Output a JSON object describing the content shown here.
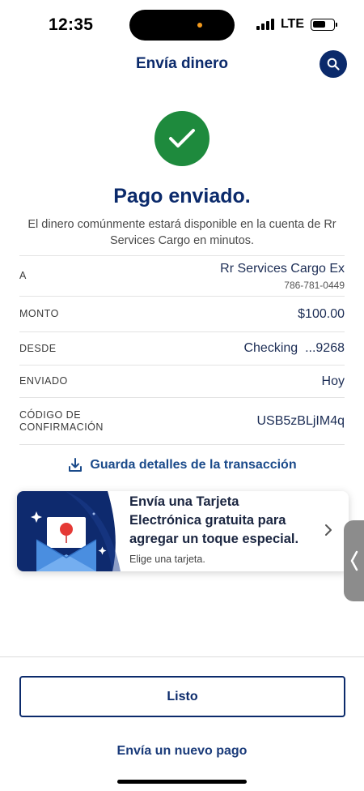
{
  "status_bar": {
    "time": "12:35",
    "network": "LTE",
    "camera_indicator_color": "#f39a1d"
  },
  "header": {
    "title": "Envía dinero",
    "search_icon": "search-icon"
  },
  "confirmation": {
    "icon": "checkmark-icon",
    "success_color": "#1e8a3d",
    "headline": "Pago enviado.",
    "message": "El dinero comúnmente estará disponible en la cuenta de Rr Services Cargo en minutos."
  },
  "details": {
    "recipient": {
      "label": "A",
      "value": "Rr Services Cargo Ex",
      "phone": "786-781-0449"
    },
    "amount": {
      "label": "MONTO",
      "value": "$100.00"
    },
    "from": {
      "label": "DESDE",
      "account": "Checking",
      "account_suffix": "...9268"
    },
    "sent": {
      "label": "ENVIADO",
      "value": "Hoy"
    },
    "confirmation_code": {
      "label_line1": "CÓDIGO DE",
      "label_line2": "CONFIRMACIÓN",
      "value": "USB5zBLjIM4q"
    }
  },
  "save_details": {
    "label": "Guarda detalles de la transacción",
    "icon": "download-icon"
  },
  "ecard_promo": {
    "title": "Envía una Tarjeta Electrónica gratuita para agregar un toque especial.",
    "subtitle": "Elige una tarjeta.",
    "icon": "envelope-card-icon",
    "chevron": "chevron-right-icon"
  },
  "side_handle": {
    "icon": "chevron-left-icon"
  },
  "actions": {
    "done": "Listo",
    "new_payment": "Envía un nuevo pago"
  },
  "colors": {
    "brand_navy": "#0b2a6b",
    "link_blue": "#1a4a8a"
  }
}
